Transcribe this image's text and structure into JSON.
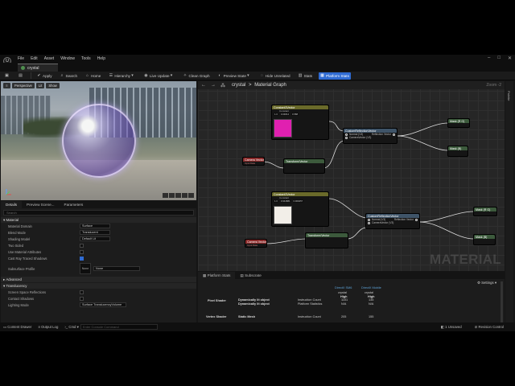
{
  "menu": [
    "File",
    "Edit",
    "Asset",
    "Window",
    "Tools",
    "Help"
  ],
  "tab": {
    "title": "crystal"
  },
  "toolbar": [
    {
      "label": "",
      "icon": "save-icon"
    },
    {
      "label": "",
      "icon": "browse-icon"
    },
    {
      "label": "Apply",
      "icon": "apply-icon"
    },
    {
      "label": "Search",
      "icon": "search-icon"
    },
    {
      "label": "Home",
      "icon": "home-icon"
    },
    {
      "label": "Hierarchy",
      "icon": "hierarchy-icon"
    },
    {
      "label": "Live Update",
      "icon": "live-update-icon"
    },
    {
      "label": "Clean Graph",
      "icon": "clean-graph-icon"
    },
    {
      "label": "Preview State",
      "icon": "preview-state-icon"
    },
    {
      "label": "Hide Unrelated",
      "icon": "hide-unrelated-icon"
    },
    {
      "label": "Stats",
      "icon": "stats-icon"
    },
    {
      "label": "Platform Stats",
      "icon": "platform-stats-icon"
    }
  ],
  "viewport": {
    "buttons": [
      "Perspective",
      "Lit",
      "Show"
    ]
  },
  "details": {
    "tabs": [
      "Details",
      "Preview Scene...",
      "Parameters"
    ],
    "search_placeholder": "Search",
    "sections": {
      "material": "Material",
      "advanced": "Advanced",
      "translucency": "Translucency"
    },
    "rows": [
      {
        "label": "Material Domain",
        "value": "Surface",
        "kind": "combo"
      },
      {
        "label": "Blend Mode",
        "value": "Translucent",
        "kind": "combo"
      },
      {
        "label": "Shading Model",
        "value": "Default Lit",
        "kind": "combo"
      },
      {
        "label": "Two Sided",
        "kind": "check",
        "checked": false
      },
      {
        "label": "Use Material Attributes",
        "kind": "check",
        "checked": false
      },
      {
        "label": "Cast Ray Traced Shadows",
        "kind": "check",
        "checked": true
      }
    ],
    "subsurface": {
      "label": "Subsurface Profile",
      "value": "None"
    },
    "trans_rows": [
      {
        "label": "Screen Space Reflections",
        "kind": "check",
        "checked": false
      },
      {
        "label": "Contact Shadows",
        "kind": "check",
        "checked": false
      },
      {
        "label": "Lighting Mode",
        "value": "Surface TranslucencyVolume",
        "kind": "combo"
      }
    ]
  },
  "graph": {
    "breadcrumb": {
      "asset": "crystal",
      "page": "Material Graph"
    },
    "zoom": "Zoom -2",
    "watermark": "MATERIAL",
    "nodes": {
      "color1": {
        "title": "Constant3Vector",
        "sub": "Constant",
        "r": "1.0",
        "g": "0.04814",
        "b": "0.588"
      },
      "color2": {
        "title": "Constant3Vector",
        "sub": "Constant",
        "r": "1.0",
        "g": "0.944881",
        "b": "0.909457"
      },
      "cam1": {
        "title": "Camera Vector",
        "sub": "Input Data"
      },
      "cam2": {
        "title": "Camera Vector",
        "sub": "Input Data"
      },
      "vt1": {
        "title": "Transform/Vector"
      },
      "vt2": {
        "title": "Transform/Vector"
      },
      "rv1": {
        "title": "CustomReflectionVector",
        "pins_in": [
          "Normal (V3)",
          "CameraVector (V3)"
        ],
        "pin_out": "Reflection Vector"
      },
      "rv2": {
        "title": "CustomReflectionVector",
        "pins_in": [
          "Normal (V3)",
          "CameraVector (V3)"
        ],
        "pin_out": "Reflection Vector"
      },
      "m1": {
        "title": "Mask (R G)"
      },
      "m2": {
        "title": "Mask (B)"
      },
      "m3": {
        "title": "Mask (R G)"
      },
      "m4": {
        "title": "Mask (B)"
      }
    }
  },
  "palette": {
    "label": "Palette"
  },
  "stats": {
    "tabs": [
      "Platform Stats",
      "Subscrate"
    ],
    "settings": "Settings",
    "columns": [
      "DirectX SM6",
      "DirectX Mobile"
    ],
    "asset_name": "crystal",
    "quality": "High",
    "rows": [
      {
        "label": "Pixel Shader",
        "lines": [
          "Dynamically lit object",
          "Dynamically lit object"
        ],
        "metrics": [
          "Instruction Count",
          "Platform Statistics"
        ],
        "v1": [
          "1101",
          "N/A"
        ],
        "v2": [
          "135",
          "N/A"
        ]
      },
      {
        "label": "Vertex Shader",
        "lines": [
          "Static Mesh"
        ],
        "metrics": [
          "Instruction Count"
        ],
        "v1": [
          "205"
        ],
        "v2": [
          "155"
        ]
      }
    ]
  },
  "statusbar": {
    "content_drawer": "Content Drawer",
    "output_log": "Output Log",
    "cmd": "Cmd",
    "cmd_placeholder": "Enter Console Command",
    "unsaved": "1 Unsaved",
    "revision": "Revision Control"
  }
}
